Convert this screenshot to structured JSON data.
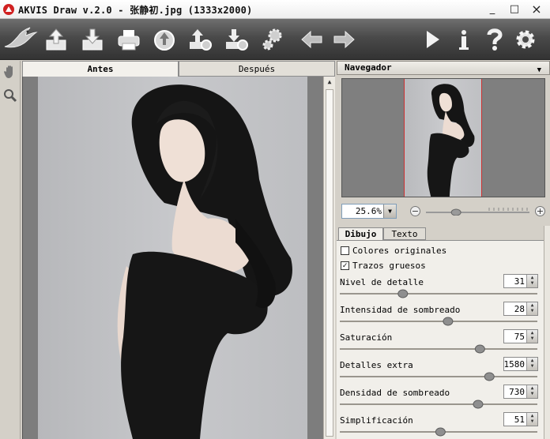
{
  "window": {
    "title": "AKVIS Draw v.2.0 - 张静初.jpg (1333x2000)",
    "minimize": "_",
    "maximize": "□",
    "close": "×"
  },
  "toolbar": {
    "icons": [
      "bird-logo",
      "open",
      "save",
      "print",
      "share",
      "import-settings",
      "export-settings",
      "preferences",
      "undo",
      "redo",
      "run",
      "info",
      "help",
      "settings"
    ]
  },
  "view_tabs": {
    "before": "Antes",
    "after": "Después"
  },
  "navigator": {
    "title": "Navegador",
    "zoom": "25.6%"
  },
  "zoom_slider": {
    "level": 0.27
  },
  "settings": {
    "tabs": [
      "Dibujo",
      "Texto"
    ],
    "checkboxes": [
      {
        "label": "Colores originales",
        "checked": false
      },
      {
        "label": "Trazos gruesos",
        "checked": true
      }
    ],
    "params": [
      {
        "label": "Nivel de detalle",
        "value": "31",
        "slider": 0.31
      },
      {
        "label": "Intensidad de sombreado",
        "value": "28",
        "slider": 0.55
      },
      {
        "label": "Saturación",
        "value": "75",
        "slider": 0.72
      },
      {
        "label": "Detalles extra",
        "value": "1580",
        "slider": 0.77
      },
      {
        "label": "Densidad de sombreado",
        "value": "730",
        "slider": 0.71
      },
      {
        "label": "Simplificación",
        "value": "51",
        "slider": 0.51
      }
    ]
  }
}
